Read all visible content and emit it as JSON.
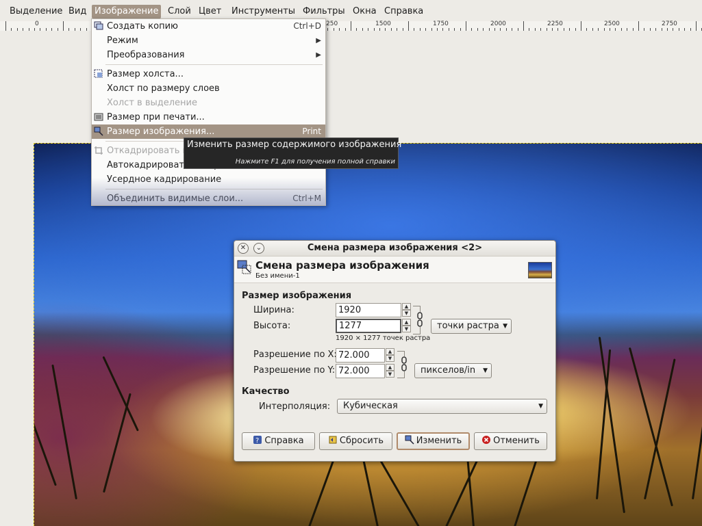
{
  "menubar": {
    "items": [
      "Выделение",
      "Вид",
      "Изображение",
      "Слой",
      "Цвет",
      "Инструменты",
      "Фильтры",
      "Окна",
      "Справка"
    ],
    "active_index": 2
  },
  "ruler": {
    "labels": [
      "0",
      "1500",
      "1750",
      "2000",
      "2250",
      "2500",
      "2750"
    ],
    "partial_label": "250"
  },
  "image_menu": {
    "items": [
      {
        "label": "Создать копию",
        "accel": "Ctrl+D",
        "icon": "duplicate-icon",
        "disabled": false,
        "submenu": false
      },
      {
        "label": "Режим",
        "accel": "",
        "icon": "",
        "disabled": false,
        "submenu": true
      },
      {
        "label": "Преобразования",
        "accel": "",
        "icon": "",
        "disabled": false,
        "submenu": true
      },
      {
        "label": "Размер холста...",
        "accel": "",
        "icon": "canvas-size-icon",
        "disabled": false,
        "submenu": false
      },
      {
        "label": "Холст по размеру слоев",
        "accel": "",
        "icon": "",
        "disabled": false,
        "submenu": false
      },
      {
        "label": "Холст в выделение",
        "accel": "",
        "icon": "",
        "disabled": true,
        "submenu": false
      },
      {
        "label": "Размер при печати...",
        "accel": "",
        "icon": "print-size-icon",
        "disabled": false,
        "submenu": false
      },
      {
        "label": "Размер изображения...",
        "accel": "Print",
        "icon": "scale-image-icon",
        "disabled": false,
        "submenu": false,
        "highlighted": true
      },
      {
        "label": "Откадрировать в выделение",
        "accel": "",
        "icon": "crop-icon",
        "disabled": true,
        "submenu": false
      },
      {
        "label": "Автокадрировать изображение",
        "accel": "",
        "icon": "",
        "disabled": false,
        "submenu": false
      },
      {
        "label": "Усердное кадрирование",
        "accel": "",
        "icon": "",
        "disabled": false,
        "submenu": false
      },
      {
        "label": "Объединить видимые слои...",
        "accel": "Ctrl+M",
        "icon": "",
        "disabled": false,
        "submenu": false
      }
    ]
  },
  "tooltip": {
    "text": "Изменить размер содержимого изображения",
    "hint": "Нажмите F1 для получения полной справки"
  },
  "dialog": {
    "title": "Смена размера изображения <2>",
    "header_title": "Смена размера изображения",
    "header_subtitle": "Без имени-1",
    "size_section": "Размер изображения",
    "width_label": "Ширина:",
    "width_value": "1920",
    "height_label": "Высота:",
    "height_value": "1277",
    "size_info": "1920 × 1277 точек растра",
    "unit_select": "точки растра",
    "xres_label": "Разрешение по X:",
    "xres_value": "72.000",
    "yres_label": "Разрешение по Y:",
    "yres_value": "72.000",
    "res_unit_select": "пикселов/in",
    "quality_section": "Качество",
    "interp_label": "Интерполяция:",
    "interp_value": "Кубическая",
    "btn_help": "Справка",
    "btn_reset": "Сбросить",
    "btn_scale": "Изменить",
    "btn_cancel": "Отменить"
  },
  "colors": {
    "menu_highlight": "#a39485",
    "selection_border": "#e0d020"
  }
}
